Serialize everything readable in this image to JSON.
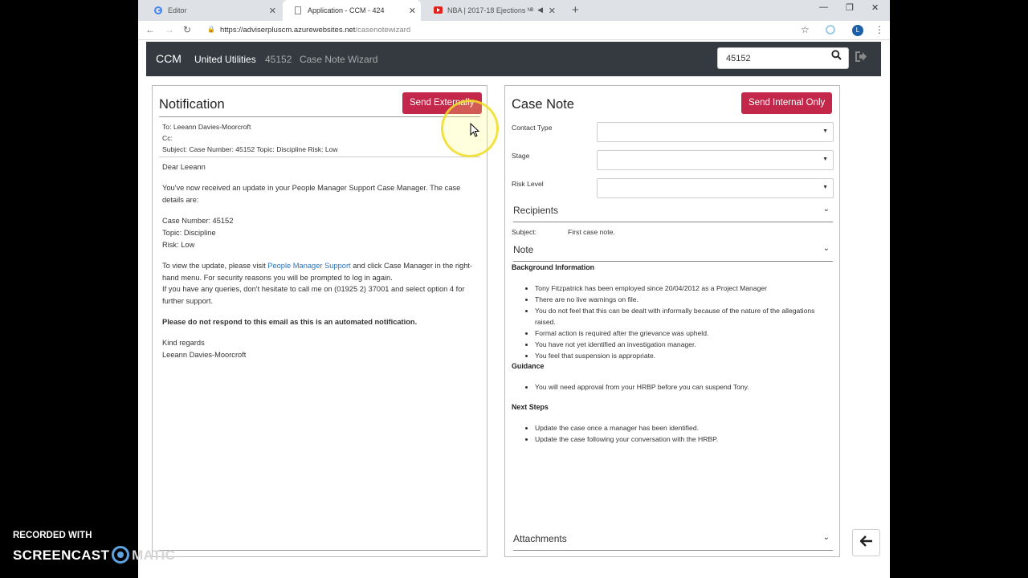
{
  "browser": {
    "tabs": [
      {
        "label": "Editor",
        "icon": "google-icon"
      },
      {
        "label": "Application - CCM - 424",
        "icon": "page-icon"
      },
      {
        "label": "NBA | 2017-18 Ejections ᴺᴮ",
        "icon": "youtube-icon"
      }
    ],
    "url_host": "https://adviserpluscm.azurewebsites.net",
    "url_path": "/casenotewizard",
    "avatar_letter": "L"
  },
  "header": {
    "brand": "CCM",
    "client": "United Utilities",
    "case_number": "45152",
    "page": "Case Note Wizard",
    "search_value": "45152"
  },
  "notification": {
    "title": "Notification",
    "send_button": "Send Externally",
    "to": "To: Leeann Davies-Moorcroft",
    "cc": "Cc:",
    "subject": "Subject: Case Number: 45152 Topic: Discipline Risk: Low",
    "greeting": "Dear Leeann",
    "intro": "You've now received an update in your People Manager Support Case Manager. The case details are:",
    "case_line": "Case Number: 45152",
    "topic_line": "Topic: Discipline",
    "risk_line": "Risk: Low",
    "view_pre": "To view the update, please visit ",
    "view_link": "People Manager Support",
    "view_post": " and click Case Manager in the right-hand menu.  For security reasons you will be prompted to log in again.",
    "queries": "If you have any queries, don't hesitate to call me on (01925 2) 37001 and select option 4 for further support.",
    "warning": "Please do not respond to this email as this is an automated notification.",
    "regards": "Kind regards",
    "signature": "Leeann Davies-Moorcroft"
  },
  "case_note": {
    "title": "Case Note",
    "send_button": "Send Internal Only",
    "contact_type_label": "Contact Type",
    "stage_label": "Stage",
    "risk_level_label": "Risk Level",
    "recipients_label": "Recipients",
    "subject_label": "Subject:",
    "subject_value": "First case note.",
    "note_label": "Note",
    "background_heading": "Background Information",
    "background_items": [
      "Tony Fitzpatrick has been employed since 20/04/2012 as a Project Manager",
      "There are no live warnings on file.",
      "You do not feel that this can be dealt with informally because of the nature of the allegations raised.",
      "Formal action is required after the grievance was upheld.",
      "You have not yet identified an investigation manager.",
      "You feel that suspension is appropriate."
    ],
    "guidance_heading": "Guidance",
    "guidance_items": [
      "You will need approval from your HRBP before you can suspend Tony."
    ],
    "next_heading": "Next Steps",
    "next_items": [
      "Update the case once a manager has been identified.",
      "Update the case following your conversation with the HRBP."
    ],
    "attachments_label": "Attachments"
  },
  "watermark": {
    "line1": "RECORDED WITH",
    "line2a": "SCREENCAST",
    "line2b": "MATIC"
  },
  "colors": {
    "accent": "#c3274a",
    "header_bg": "#343a40",
    "link": "#2a73b8"
  }
}
